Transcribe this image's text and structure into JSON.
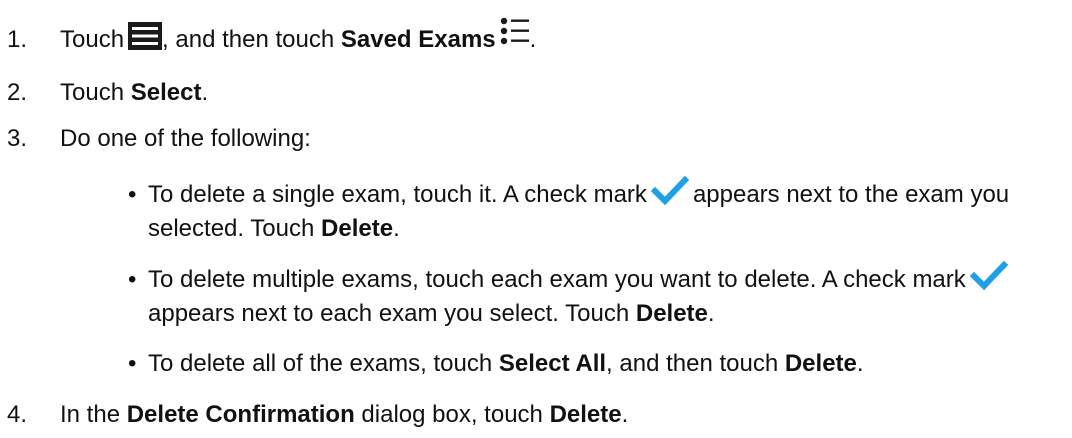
{
  "steps": [
    {
      "num": "1.",
      "pre": "Touch",
      "mid": ", and then touch ",
      "bold": "Saved Exams",
      "post": "."
    },
    {
      "num": "2.",
      "pre": "Touch ",
      "bold": "Select",
      "post": "."
    },
    {
      "num": "3.",
      "text": "Do one of the following:"
    },
    {
      "num": "4.",
      "pre": "In the ",
      "bold1": "Delete Confirmation",
      "mid": " dialog box, touch ",
      "bold2": "Delete",
      "post": "."
    }
  ],
  "bullets": [
    {
      "line1_pre": "To delete a single exam, touch it. A check mark",
      "line1_post": "appears next to the exam you",
      "line2_pre": "selected. Touch ",
      "line2_bold": "Delete",
      "line2_post": "."
    },
    {
      "line1_pre": "To delete multiple exams, touch each exam you want to delete. A check mark",
      "line2_pre": "appears next to each exam you select. Touch ",
      "line2_bold": "Delete",
      "line2_post": "."
    },
    {
      "pre": "To delete all of the exams, touch ",
      "bold1": "Select All",
      "mid": ", and then touch ",
      "bold2": "Delete",
      "post": "."
    }
  ],
  "icons": {
    "menu": "menu-icon",
    "saved_exams": "list-icon",
    "check": "check-icon"
  },
  "colors": {
    "icon_dark": "#1a1a1a",
    "check_blue": "#1ea0e6",
    "text": "#111111"
  }
}
